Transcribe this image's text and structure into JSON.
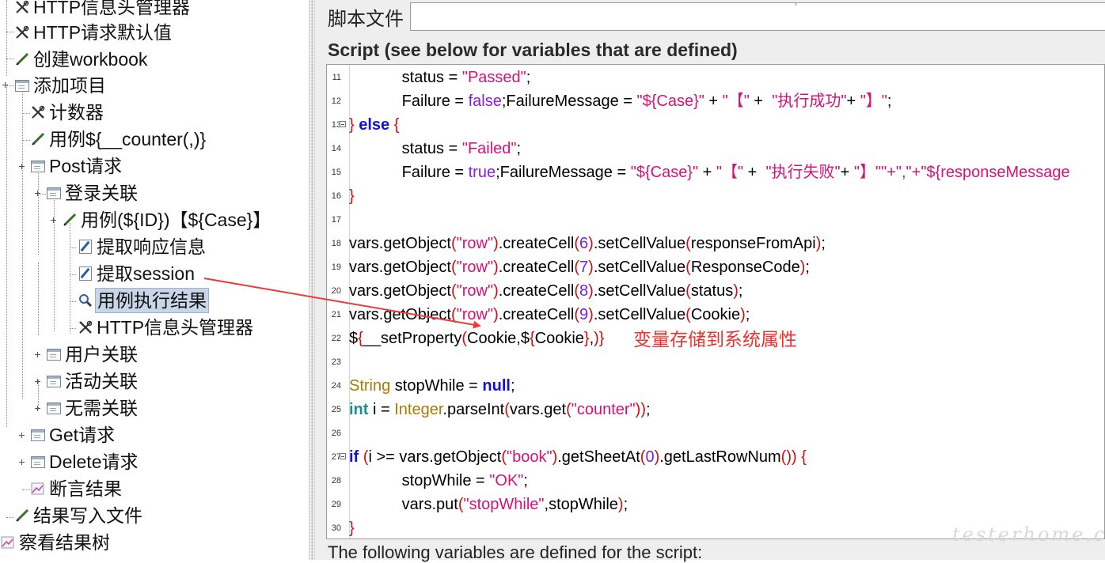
{
  "tree": {
    "items": [
      {
        "label": "HTTP信息头管理器",
        "icon": "wrench-scissors-icon"
      },
      {
        "label": "HTTP请求默认值",
        "icon": "wrench-scissors-icon"
      },
      {
        "label": "创建workbook",
        "icon": "pen-icon"
      },
      {
        "label": "添加项目",
        "icon": "page-icon"
      },
      {
        "label": "计数器",
        "icon": "wrench-scissors-icon"
      },
      {
        "label": "用例${__counter(,)}",
        "icon": "pen-icon"
      },
      {
        "label": "Post请求",
        "icon": "page-icon"
      },
      {
        "label": "登录关联",
        "icon": "page-icon"
      },
      {
        "label": "用例(${ID})【${Case}】",
        "icon": "pen-icon"
      },
      {
        "label": "提取响应信息",
        "icon": "note-icon"
      },
      {
        "label": "提取session",
        "icon": "note-icon"
      },
      {
        "label": "用例执行结果",
        "icon": "magnifier-icon",
        "selected": true
      },
      {
        "label": "HTTP信息头管理器",
        "icon": "wrench-scissors-icon"
      },
      {
        "label": "用户关联",
        "icon": "page-icon"
      },
      {
        "label": "活动关联",
        "icon": "page-icon"
      },
      {
        "label": "无需关联",
        "icon": "page-icon"
      },
      {
        "label": "Get请求",
        "icon": "page-icon"
      },
      {
        "label": "Delete请求",
        "icon": "page-icon"
      },
      {
        "label": "断言结果",
        "icon": "graph-icon"
      },
      {
        "label": "结果写入文件",
        "icon": "pen-icon"
      },
      {
        "label": "察看结果树",
        "icon": "graph-icon"
      }
    ]
  },
  "panel": {
    "file_label": "脚本文件",
    "file_value": "",
    "script_label": "Script (see below for variables that are defined)",
    "footer_text": "The following variables are defined for the script:"
  },
  "editor": {
    "lines": [
      {
        "no": "11",
        "tokens": [
          [
            "",
            "            status = "
          ],
          [
            "str",
            "\"Passed\""
          ],
          [
            "",
            ";"
          ]
        ]
      },
      {
        "no": "12",
        "tokens": [
          [
            "",
            "            Failure = "
          ],
          [
            "bool",
            "false"
          ],
          [
            "",
            ";FailureMessage = "
          ],
          [
            "str",
            "\"${Case}\""
          ],
          [
            "",
            " + "
          ],
          [
            "str",
            "\"【\""
          ],
          [
            "",
            " +  "
          ],
          [
            "str",
            "\"执行成功\""
          ],
          [
            "",
            "+ "
          ],
          [
            "str",
            "\"】\""
          ],
          [
            "",
            ";"
          ]
        ]
      },
      {
        "no": "13",
        "fold": true,
        "tokens": [
          [
            "paren",
            "}"
          ],
          [
            "",
            " "
          ],
          [
            "kw",
            "else"
          ],
          [
            "",
            " "
          ],
          [
            "paren",
            "{"
          ]
        ]
      },
      {
        "no": "14",
        "tokens": [
          [
            "",
            "            status = "
          ],
          [
            "str",
            "\"Failed\""
          ],
          [
            "",
            ";"
          ]
        ]
      },
      {
        "no": "15",
        "tokens": [
          [
            "",
            "            Failure = "
          ],
          [
            "bool",
            "true"
          ],
          [
            "",
            ";FailureMessage = "
          ],
          [
            "str",
            "\"${Case}\""
          ],
          [
            "",
            " + "
          ],
          [
            "str",
            "\"【\""
          ],
          [
            "",
            " +  "
          ],
          [
            "str",
            "\"执行失败\""
          ],
          [
            "",
            "+ "
          ],
          [
            "str",
            "\"】\""
          ],
          [
            "str",
            "\"+\",\"+\"${responseMessage"
          ]
        ]
      },
      {
        "no": "16",
        "tokens": [
          [
            "paren",
            "}"
          ]
        ]
      },
      {
        "no": "17",
        "tokens": []
      },
      {
        "no": "18",
        "tokens": [
          [
            "",
            "vars.getObject"
          ],
          [
            "paren",
            "("
          ],
          [
            "str",
            "\"row\""
          ],
          [
            "paren",
            ")"
          ],
          [
            "",
            ".createCell"
          ],
          [
            "paren",
            "("
          ],
          [
            "num",
            "6"
          ],
          [
            "paren",
            ")"
          ],
          [
            "",
            ".setCellValue"
          ],
          [
            "paren",
            "("
          ],
          [
            "",
            "responseFromApi"
          ],
          [
            "paren",
            ")"
          ],
          [
            "",
            ";"
          ]
        ]
      },
      {
        "no": "19",
        "tokens": [
          [
            "",
            "vars.getObject"
          ],
          [
            "paren",
            "("
          ],
          [
            "str",
            "\"row\""
          ],
          [
            "paren",
            ")"
          ],
          [
            "",
            ".createCell"
          ],
          [
            "paren",
            "("
          ],
          [
            "num",
            "7"
          ],
          [
            "paren",
            ")"
          ],
          [
            "",
            ".setCellValue"
          ],
          [
            "paren",
            "("
          ],
          [
            "",
            "ResponseCode"
          ],
          [
            "paren",
            ")"
          ],
          [
            "",
            ";"
          ]
        ]
      },
      {
        "no": "20",
        "tokens": [
          [
            "",
            "vars.getObject"
          ],
          [
            "paren",
            "("
          ],
          [
            "str",
            "\"row\""
          ],
          [
            "paren",
            ")"
          ],
          [
            "",
            ".createCell"
          ],
          [
            "paren",
            "("
          ],
          [
            "num",
            "8"
          ],
          [
            "paren",
            ")"
          ],
          [
            "",
            ".setCellValue"
          ],
          [
            "paren",
            "("
          ],
          [
            "",
            "status"
          ],
          [
            "paren",
            ")"
          ],
          [
            "",
            ";"
          ]
        ]
      },
      {
        "no": "21",
        "tokens": [
          [
            "",
            "vars.getObject"
          ],
          [
            "paren",
            "("
          ],
          [
            "str",
            "\"row\""
          ],
          [
            "paren",
            ")"
          ],
          [
            "",
            ".createCell"
          ],
          [
            "paren",
            "("
          ],
          [
            "num",
            "9"
          ],
          [
            "paren",
            ")"
          ],
          [
            "",
            ".setCellValue"
          ],
          [
            "paren",
            "("
          ],
          [
            "",
            "Cookie"
          ],
          [
            "paren",
            ")"
          ],
          [
            "",
            ";"
          ]
        ]
      },
      {
        "no": "22",
        "tokens": [
          [
            "",
            "$"
          ],
          [
            "paren",
            "{"
          ],
          [
            "",
            "__setProperty"
          ],
          [
            "paren",
            "("
          ],
          [
            "",
            "Cookie,$"
          ],
          [
            "paren",
            "{"
          ],
          [
            "",
            "Cookie"
          ],
          [
            "paren",
            "}"
          ],
          [
            "",
            ","
          ],
          [
            "paren",
            ")}"
          ]
        ]
      },
      {
        "no": "23",
        "tokens": []
      },
      {
        "no": "24",
        "tokens": [
          [
            "type",
            "String"
          ],
          [
            "",
            " stopWhile = "
          ],
          [
            "kw",
            "null"
          ],
          [
            "",
            ";"
          ]
        ]
      },
      {
        "no": "25",
        "tokens": [
          [
            "int",
            "int"
          ],
          [
            "",
            " i = "
          ],
          [
            "type",
            "Integer"
          ],
          [
            "",
            ".parseInt"
          ],
          [
            "paren",
            "("
          ],
          [
            "",
            "vars.get"
          ],
          [
            "paren",
            "("
          ],
          [
            "str",
            "\"counter\""
          ],
          [
            "paren",
            "))"
          ],
          [
            "",
            ";"
          ]
        ]
      },
      {
        "no": "26",
        "tokens": []
      },
      {
        "no": "27",
        "fold": true,
        "tokens": [
          [
            "kw",
            "if"
          ],
          [
            "",
            " "
          ],
          [
            "paren",
            "("
          ],
          [
            "",
            "i >= vars.getObject"
          ],
          [
            "paren",
            "("
          ],
          [
            "str",
            "\"book\""
          ],
          [
            "paren",
            ")"
          ],
          [
            "",
            ".getSheetAt"
          ],
          [
            "paren",
            "("
          ],
          [
            "num",
            "0"
          ],
          [
            "paren",
            ")"
          ],
          [
            "",
            ".getLastRowNum"
          ],
          [
            "paren",
            "())"
          ],
          [
            "",
            " "
          ],
          [
            "paren",
            "{"
          ]
        ]
      },
      {
        "no": "28",
        "tokens": [
          [
            "",
            "            stopWhile = "
          ],
          [
            "str",
            "\"OK\""
          ],
          [
            "",
            ";"
          ]
        ]
      },
      {
        "no": "29",
        "tokens": [
          [
            "",
            "            vars.put"
          ],
          [
            "paren",
            "("
          ],
          [
            "str",
            "\"stopWhile\""
          ],
          [
            "",
            ",stopWhile"
          ],
          [
            "paren",
            ")"
          ],
          [
            "",
            ";"
          ]
        ]
      },
      {
        "no": "30",
        "tokens": [
          [
            "paren",
            "}"
          ]
        ]
      }
    ]
  },
  "annotation": {
    "text": "变量存储到系统属性",
    "color": "#ef3030"
  },
  "watermark": "testerhome.com",
  "colors": {
    "string": "#d4127b",
    "keyword": "#1111dd",
    "paren": "#cc1010",
    "type": "#a97a06",
    "selection": "#c8d6e8"
  }
}
